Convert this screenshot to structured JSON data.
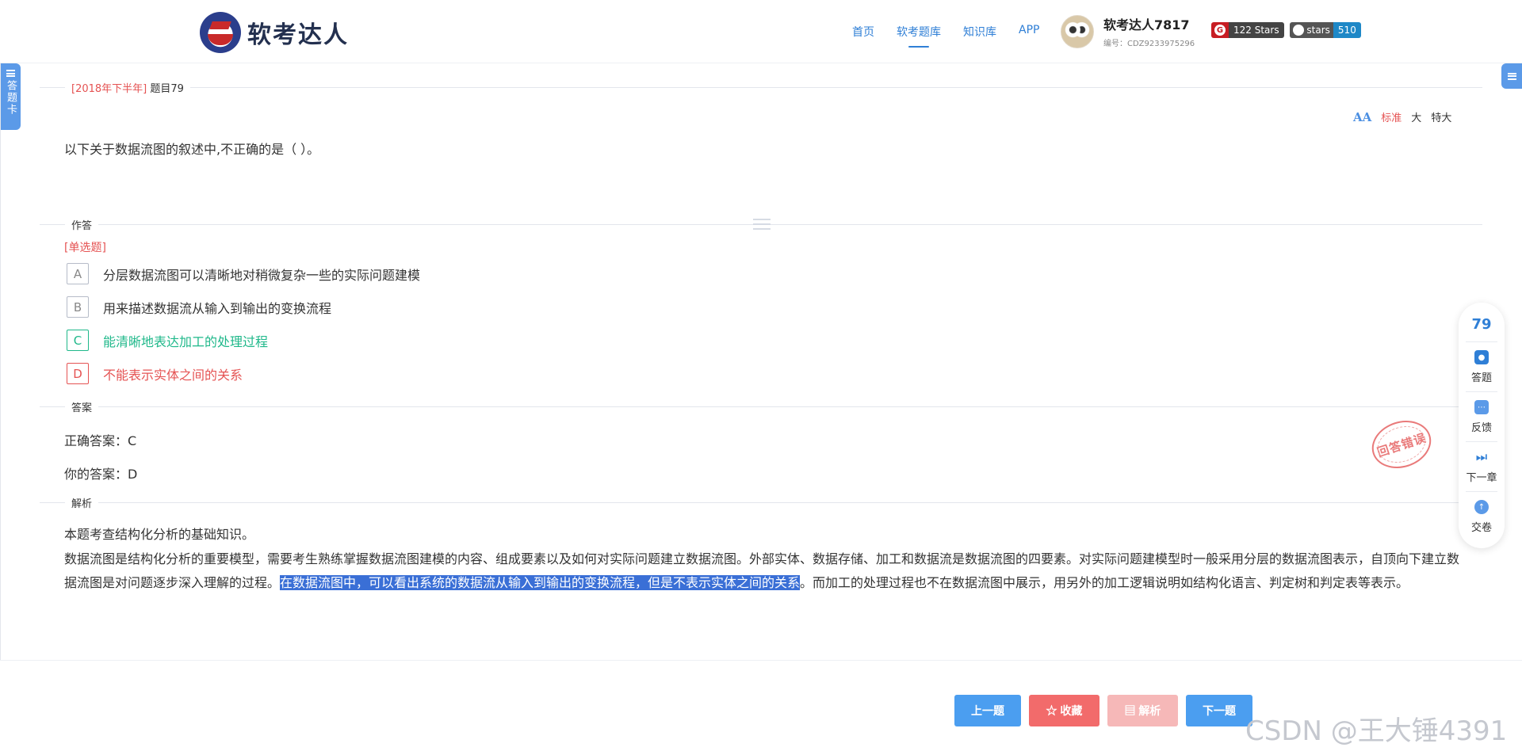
{
  "header": {
    "logo_text": "软考达人",
    "nav": [
      "首页",
      "软考题库",
      "知识库",
      "APP"
    ],
    "nav_active": "软考题库",
    "user_name": "软考达人7817",
    "user_id": "编号：CDZ9233975296",
    "badge_gitee_value": "122 Stars",
    "badge_github_label": "stars",
    "badge_github_value": "510"
  },
  "side": {
    "answer_card": "答题卡"
  },
  "meta": {
    "year_tag": "[2018年下半年]",
    "question_no": "题目79"
  },
  "font_size": {
    "options": [
      "标准",
      "大",
      "特大"
    ],
    "active": "标准"
  },
  "question": {
    "text": "以下关于数据流图的叙述中,不正确的是（ ）。"
  },
  "sections": {
    "answer_input": "作答",
    "answer": "答案",
    "analysis": "解析"
  },
  "question_type": "[单选题]",
  "options": [
    {
      "key": "A",
      "text": "分层数据流图可以清晰地对稍微复杂一些的实际问题建模",
      "state": "normal"
    },
    {
      "key": "B",
      "text": "用来描述数据流从输入到输出的变换流程",
      "state": "normal"
    },
    {
      "key": "C",
      "text": "能清晰地表达加工的处理过程",
      "state": "correct"
    },
    {
      "key": "D",
      "text": "不能表示实体之间的关系",
      "state": "wrong"
    }
  ],
  "answer": {
    "correct": "正确答案：C",
    "yours": "你的答案：D",
    "stamp": "回答错误"
  },
  "analysis": {
    "line1": "本题考查结构化分析的基础知识。",
    "before_highlight": "数据流图是结构化分析的重要模型，需要考生熟练掌握数据流图建模的内容、组成要素以及如何对实际问题建立数据流图。外部实体、数据存储、加工和数据流是数据流图的四要素。对实际问题建模型时一般采用分层的数据流图表示，自顶向下建立数据流图是对问题逐步深入理解的过程。",
    "highlight": "在数据流图中，可以看出系统的数据流从输入到输出的变换流程，但是不表示实体之间的关系",
    "after_highlight": "。而加工的处理过程也不在数据流图中展示，用另外的加工逻辑说明如结构化语言、判定树和判定表等表示。"
  },
  "tool_panel": {
    "number": "79",
    "items": [
      {
        "label": "答题",
        "icon": "answer-sheet-icon"
      },
      {
        "label": "反馈",
        "icon": "feedback-icon"
      },
      {
        "label": "下一章",
        "icon": "next-chapter-icon"
      },
      {
        "label": "交卷",
        "icon": "submit-icon"
      }
    ]
  },
  "buttons": {
    "prev": "上一题",
    "favorite": "☆ 收藏",
    "analysis": "▤ 解析",
    "next": "下一题"
  },
  "watermark": "CSDN @王大锤4391",
  "colors": {
    "accent": "#2f7fd6",
    "correct": "#1fb88a",
    "wrong": "#e55353",
    "highlight": "#3a6fd6"
  }
}
